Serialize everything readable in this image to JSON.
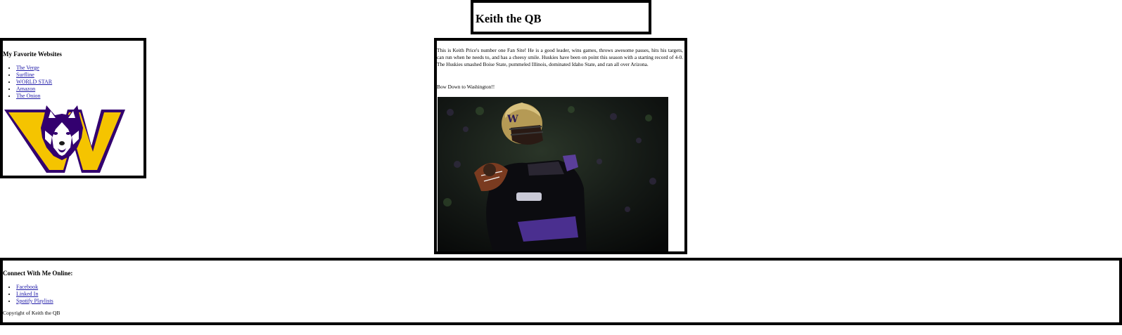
{
  "header": {
    "title": "Keith the QB"
  },
  "sidebar": {
    "heading": "My Favorite Websites",
    "links": [
      "The Verge",
      "Surfline",
      "WORLD STAR",
      "Amazon",
      "The Onion"
    ]
  },
  "logo": {
    "icon": "uw-husky-w-logo-icon"
  },
  "content": {
    "intro": "This is Keith Price's number one Fan Site! He is a good leader, wins games, throws awesome passes, hits his targets, can run when he needs to, and has a cheesy smile. Huskies have been on point this season with a starting record of 4-0. The Huskies smashed Boise State, pummeled Illinois, dominated Idaho State, and ran all over Arizona.",
    "tagline": "Bow Down to Washington!!",
    "photo_icon": "quarterback-photo"
  },
  "footer": {
    "heading": "Connect With Me Online:",
    "links": [
      "Facebook",
      "Linked In",
      "Spotify Playlists"
    ],
    "copyright": "Copyright of Keith the QB"
  },
  "colors": {
    "link": "#1f1aa8",
    "husky_purple": "#33006f",
    "husky_gold": "#f5c400",
    "border": "#000000"
  }
}
